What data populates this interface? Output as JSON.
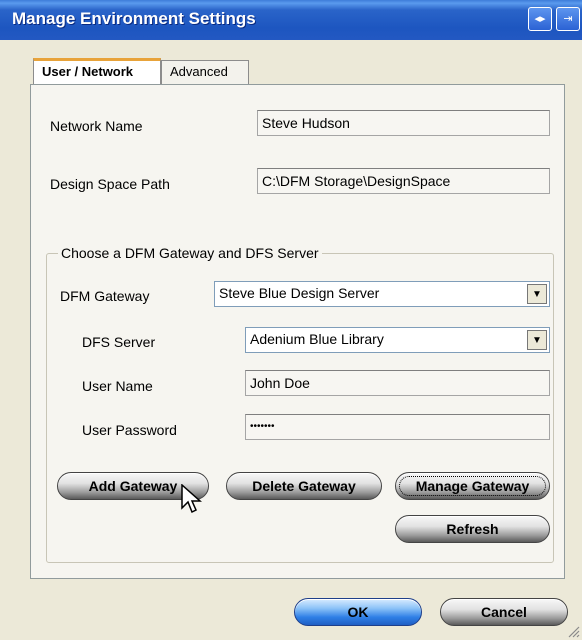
{
  "window": {
    "title": "Manage Environment Settings",
    "title_buttons": [
      {
        "icon": "left-right-arrows-icon",
        "glyph": "◂▸"
      },
      {
        "icon": "exit-icon",
        "glyph": "⇥"
      }
    ]
  },
  "tabs": [
    {
      "label": "User / Network",
      "active": true
    },
    {
      "label": "Advanced",
      "active": false
    }
  ],
  "fields": {
    "network_name": {
      "label": "Network Name",
      "value": "Steve Hudson"
    },
    "design_space_path": {
      "label": "Design Space Path",
      "value": "C:\\DFM Storage\\DesignSpace"
    }
  },
  "gateway_group": {
    "legend": "Choose a DFM Gateway and DFS Server",
    "dfm_gateway": {
      "label": "DFM Gateway",
      "value": "Steve Blue Design Server"
    },
    "dfs_server": {
      "label": "DFS Server",
      "value": "Adenium Blue Library"
    },
    "user_name": {
      "label": "User Name",
      "value": "John Doe"
    },
    "user_password": {
      "label": "User Password",
      "value": "•••••••"
    },
    "buttons": {
      "add": "Add Gateway",
      "delete": "Delete Gateway",
      "manage": "Manage Gateway",
      "refresh": "Refresh"
    }
  },
  "footer": {
    "ok": "OK",
    "cancel": "Cancel"
  }
}
